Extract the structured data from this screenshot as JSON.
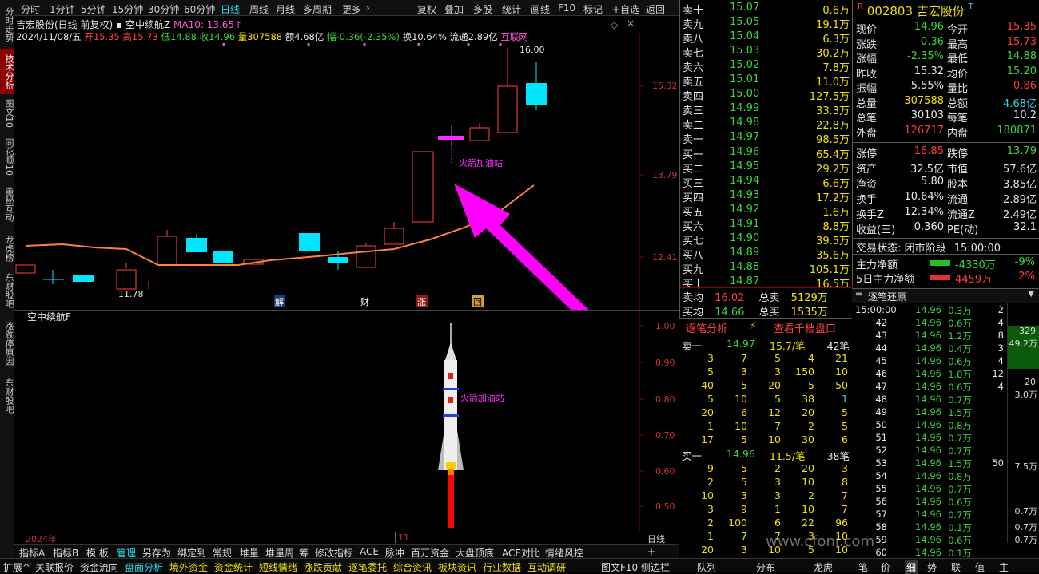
{
  "leftnav": [
    "分时走势",
    "技术分析",
    "图文10",
    "同花顺10",
    "董秘互动",
    "龙虎榜",
    "东财股吧",
    "涨跌停原因",
    "东财股吧"
  ],
  "periods": [
    "分时",
    "1分钟",
    "5分钟",
    "15分钟",
    "30分钟",
    "60分钟",
    "日线",
    "周线",
    "月线",
    "多周期",
    "更多"
  ],
  "tools": [
    "复权",
    "叠加",
    "多股",
    "统计",
    "画线",
    "F10",
    "标记",
    "+自选",
    "返回"
  ],
  "hdr": {
    "name": "吉宏股份(日线 前复权)",
    "indicator": "空中续航Z",
    "ma": "MA10: 13.65↑",
    "date": "2024/11/08/五",
    "open_l": "开",
    "open": "15.35",
    "high_l": "高",
    "high": "15.73",
    "low_l": "低",
    "low": "14.88",
    "close_l": "收",
    "close": "14.96",
    "vol_l": "量",
    "vol": "307588",
    "amt": "额4.68亿",
    "chg_l": "幅",
    "chg": "-0.36(-2.35%)",
    "turn": "换10.64%",
    "float": "流通2.89亿",
    "src": "互联网"
  },
  "price_axis": [
    "15.32",
    "13.79",
    "12.41"
  ],
  "annot": {
    "high": "16.00",
    "low": "11.78",
    "signal": "火箭加油站",
    "markers": [
      "解",
      "财",
      "涨",
      "回"
    ]
  },
  "sub": {
    "title": "空中续航F",
    "axis": [
      "1.00",
      "0.90",
      "0.80",
      "0.70",
      "0.60",
      "0.50"
    ],
    "label": "火箭加油站"
  },
  "dates": {
    "year": "2024年",
    "month": "11",
    "period": "日线"
  },
  "btm_tabs": [
    "指标A",
    "指标B",
    "模 板",
    "管理",
    "另存为",
    "绑定到",
    "常规",
    "堆量",
    "堆量周",
    "筹",
    "修改指标",
    "ACE",
    "脉冲",
    "百万资金",
    "大盘顶底",
    "ACE对比",
    "情绪风控"
  ],
  "status": [
    "扩展^",
    "关联报价",
    "资金流向",
    "盘面分析",
    "境外资金",
    "资金统计",
    "短线情绪",
    "涨跌贡献",
    "逐笔委托",
    "综合资讯",
    "板块资讯",
    "行业数据",
    "互动调研",
    "图文F10",
    "侧边栏"
  ],
  "status_right": [
    "队列",
    "分布",
    "龙虎",
    "笔",
    "价",
    "细",
    "势",
    "联",
    "值",
    "主"
  ],
  "sell": [
    {
      "l": "卖十",
      "p": "15.07",
      "v": "0.6万"
    },
    {
      "l": "卖九",
      "p": "15.05",
      "v": "19.1万"
    },
    {
      "l": "卖八",
      "p": "15.04",
      "v": "6.3万"
    },
    {
      "l": "卖七",
      "p": "15.03",
      "v": "30.2万"
    },
    {
      "l": "卖六",
      "p": "15.02",
      "v": "7.8万"
    },
    {
      "l": "卖五",
      "p": "15.01",
      "v": "11.0万"
    },
    {
      "l": "卖四",
      "p": "15.00",
      "v": "127.5万"
    },
    {
      "l": "卖三",
      "p": "14.99",
      "v": "33.3万"
    },
    {
      "l": "卖二",
      "p": "14.98",
      "v": "22.8万"
    },
    {
      "l": "卖一",
      "p": "14.97",
      "v": "98.5万"
    }
  ],
  "buy": [
    {
      "l": "买一",
      "p": "14.96",
      "v": "65.4万"
    },
    {
      "l": "买二",
      "p": "14.95",
      "v": "29.2万"
    },
    {
      "l": "买三",
      "p": "14.94",
      "v": "6.6万"
    },
    {
      "l": "买四",
      "p": "14.93",
      "v": "17.2万"
    },
    {
      "l": "买五",
      "p": "14.92",
      "v": "1.6万"
    },
    {
      "l": "买六",
      "p": "14.91",
      "v": "8.8万"
    },
    {
      "l": "买七",
      "p": "14.90",
      "v": "39.5万"
    },
    {
      "l": "买八",
      "p": "14.89",
      "v": "35.6万"
    },
    {
      "l": "买九",
      "p": "14.88",
      "v": "105.1万"
    },
    {
      "l": "买十",
      "p": "14.87",
      "v": "16.5万"
    }
  ],
  "avg": {
    "sell_l": "卖均",
    "sell": "16.02",
    "tsell_l": "总卖",
    "tsell": "5129万",
    "buy_l": "买均",
    "buy": "14.66",
    "tbuy_l": "总买",
    "tbuy": "1535万"
  },
  "btn": {
    "a": "逐笔分析",
    "b": "查看千档盘口"
  },
  "q1": {
    "l": "卖一",
    "p": "14.97",
    "v": "15.7/笔",
    "n": "42笔",
    "rows": [
      [
        "3",
        "7",
        "5",
        "4",
        "21"
      ],
      [
        "5",
        "3",
        "3",
        "150",
        "10"
      ],
      [
        "40",
        "5",
        "20",
        "5",
        "50"
      ],
      [
        "5",
        "10",
        "5",
        "38",
        "1"
      ],
      [
        "20",
        "6",
        "12",
        "20",
        "5"
      ],
      [
        "1",
        "10",
        "7",
        "2",
        "5"
      ],
      [
        "17",
        "5",
        "10",
        "30",
        "6"
      ]
    ]
  },
  "q2": {
    "l": "买一",
    "p": "14.96",
    "v": "11.5/笔",
    "n": "38笔",
    "rows": [
      [
        "9",
        "5",
        "2",
        "20",
        "3"
      ],
      [
        "2",
        "5",
        "3",
        "10",
        "8"
      ],
      [
        "10",
        "3",
        "3",
        "2",
        "7"
      ],
      [
        "3",
        "9",
        "1",
        "10",
        "7"
      ],
      [
        "2",
        "100",
        "6",
        "22",
        "96"
      ],
      [
        "1",
        "7",
        "7",
        "3",
        "10"
      ],
      [
        "20",
        "3",
        "10",
        "5",
        "10"
      ]
    ]
  },
  "stock": {
    "code": "002803",
    "name": "吉宏股份"
  },
  "info": [
    {
      "a": "现价",
      "av": "14.96",
      "b": "今开",
      "bv": "15.35"
    },
    {
      "a": "涨跌",
      "av": "-0.36",
      "b": "最高",
      "bv": "15.73"
    },
    {
      "a": "涨幅",
      "av": "-2.35%",
      "b": "最低",
      "bv": "14.88"
    },
    {
      "a": "昨收",
      "av": "15.32",
      "b": "均价",
      "bv": "15.20"
    },
    {
      "a": "振幅",
      "av": "5.55%",
      "b": "量比",
      "bv": "0.86"
    },
    {
      "a": "总量",
      "av": "307588",
      "b": "总额",
      "bv": "4.68亿"
    },
    {
      "a": "总笔",
      "av": "30103",
      "b": "每笔",
      "bv": "10.2"
    },
    {
      "a": "外盘",
      "av": "126717",
      "b": "内盘",
      "bv": "180871"
    },
    {
      "a": "涨停",
      "av": "16.85",
      "b": "跌停",
      "bv": "13.79"
    },
    {
      "a": "资产",
      "av": "32.5亿",
      "b": "市值",
      "bv": "57.6亿"
    },
    {
      "a": "净资",
      "av": "5.80",
      "b": "股本",
      "bv": "3.85亿"
    },
    {
      "a": "换手",
      "av": "10.64%",
      "b": "流通",
      "bv": "2.89亿"
    },
    {
      "a": "换手Z",
      "av": "12.34%",
      "b": "流通Z",
      "bv": "2.49亿"
    },
    {
      "a": "收益(三)",
      "av": "0.360",
      "b": "PE(动)",
      "bv": "32.1"
    }
  ],
  "trade": {
    "label": "交易状态:",
    "state": "闭市阶段",
    "time": "15:00:00"
  },
  "flow": [
    {
      "l": "主力净额",
      "v": "-4330万",
      "p": "-9%"
    },
    {
      "l": "5日主力净额",
      "v": "4459万",
      "p": "2%"
    }
  ],
  "ticks_title": "逐笔还原",
  "ticks": [
    [
      "15:00:00",
      "14.96",
      "0.3万",
      "2"
    ],
    [
      "42",
      "14.96",
      "0.6万",
      "4"
    ],
    [
      "43",
      "14.96",
      "1.2万",
      "8"
    ],
    [
      "44",
      "14.96",
      "0.4万",
      "3"
    ],
    [
      "45",
      "14.96",
      "0.6万",
      "4"
    ],
    [
      "46",
      "14.96",
      "1.8万",
      "12"
    ],
    [
      "47",
      "14.96",
      "0.6万",
      "4"
    ],
    [
      "48",
      "14.96",
      "0.7万",
      ""
    ],
    [
      "49",
      "14.96",
      "1.5万",
      ""
    ],
    [
      "50",
      "14.96",
      "0.8万",
      ""
    ],
    [
      "51",
      "14.96",
      "0.7万",
      ""
    ],
    [
      "52",
      "14.96",
      "0.7万",
      ""
    ],
    [
      "53",
      "14.96",
      "1.5万",
      "50"
    ],
    [
      "54",
      "14.96",
      "0.8万",
      ""
    ],
    [
      "55",
      "14.96",
      "0.7万",
      ""
    ],
    [
      "56",
      "14.96",
      "0.6万",
      ""
    ],
    [
      "57",
      "14.96",
      "0.7万",
      ""
    ],
    [
      "58",
      "14.96",
      "0.1万",
      ""
    ],
    [
      "59",
      "14.96",
      "0.6万",
      ""
    ],
    [
      "60",
      "14.96",
      "0.1万",
      ""
    ]
  ],
  "tick_side": [
    "329",
    "49.2万",
    "20",
    "3.0万",
    "7.5万",
    "0.7万",
    "0.7万",
    "0.7万"
  ],
  "watermark": "www.cfoni.com"
}
